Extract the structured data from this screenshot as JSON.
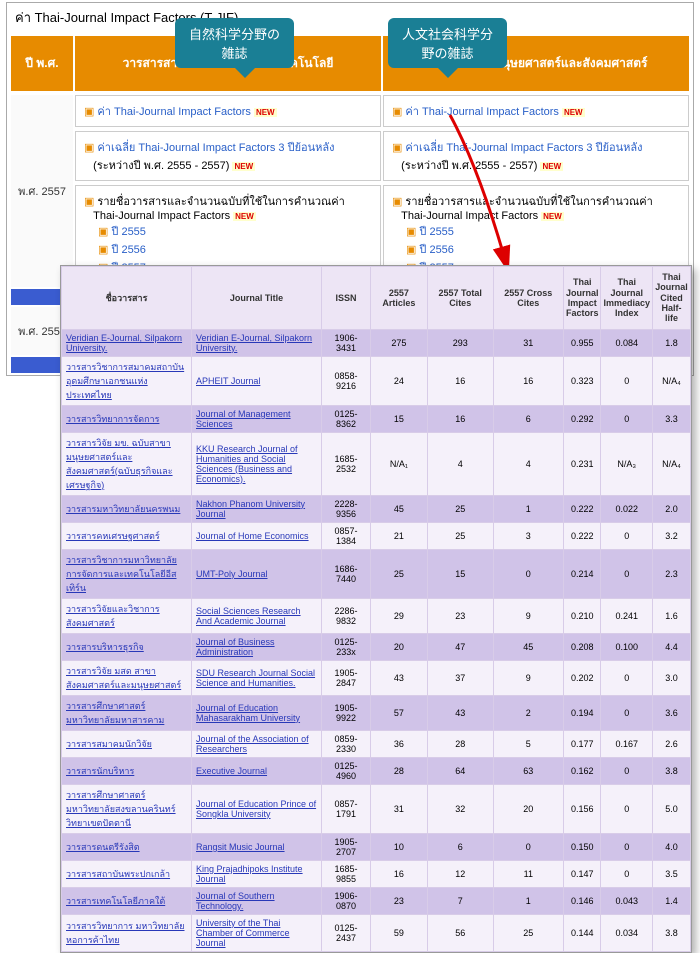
{
  "panel1": {
    "title": "ค่า Thai-Journal Impact Factors (T-JIF)",
    "callout1": "自然科学分野の<br>雑誌",
    "callout2": "人文社会科学分<br>野の雑誌",
    "year_hdr": "ปี พ.ศ.",
    "col1_hdr": "วารสารสาขาวิทยาศาสตร์และเทคโนโลยี",
    "col2_hdr": "วารสารสาขามนุษยศาสตร์และสังคมศาสตร์",
    "row_year": "พ.ศ. 2557",
    "link_a": "ค่า Thai-Journal Impact Factors",
    "avg_a": "ค่าเฉลี่ย Thai-Journal Impact Factors 3 ปีย้อนหลัง",
    "avg_a2": "(ระหว่างปี พ.ศ. 2555 - 2557)",
    "list_hdr": "รายชื่อวารสารและจำนวนฉบับที่ใช้ในการคำนวณค่า",
    "list_hdr2": "Thai-Journal Impact Factors",
    "y1": "ปี 2555",
    "y2": "ปี 2556",
    "y3": "ปี 2557",
    "row_year2": "พ.ศ. 2556",
    "new": "NEW"
  },
  "chart_data": {
    "type": "table",
    "columns": [
      "ชื่อวารสาร",
      "Journal Title",
      "ISSN",
      "2557 Articles",
      "2557 Total Cites",
      "2557 Cross Cites",
      "Thai Journal Impact Factors",
      "Thai Journal Immediacy Index",
      "Thai Journal Cited Half-life"
    ],
    "rows": [
      [
        "Veridian E-Journal, Silpakorn University.",
        "Veridian E-Journal, Silpakorn University.",
        "1906-3431",
        "275",
        "293",
        "31",
        "0.955",
        "0.084",
        "1.8"
      ],
      [
        "วารสารวิชาการสมาคมสถาบันอุดมศึกษาเอกชนแห่งประเทศไทย",
        "APHEIT Journal",
        "0858-9216",
        "24",
        "16",
        "16",
        "0.323",
        "0",
        "N/A₄"
      ],
      [
        "วารสารวิทยาการจัดการ",
        "Journal of Management Sciences",
        "0125-8362",
        "15",
        "16",
        "6",
        "0.292",
        "0",
        "3.3"
      ],
      [
        "วารสารวิจัย มข. ฉบับสาขามนุษยศาสตร์และสังคมศาสตร์(ฉบับธุรกิจและเศรษฐกิจ)",
        "KKU Research Journal of Humanities and Social Sciences (Business and Economics).",
        "1685-2532",
        "N/A₁",
        "4",
        "4",
        "0.231",
        "N/A₃",
        "N/A₄"
      ],
      [
        "วารสารมหาวิทยาลัยนครพนม",
        "Nakhon Phanom University Journal",
        "2228-9356",
        "45",
        "25",
        "1",
        "0.222",
        "0.022",
        "2.0"
      ],
      [
        "วารสารคหเศรษฐศาสตร์",
        "Journal of Home Economics",
        "0857-1384",
        "21",
        "25",
        "3",
        "0.222",
        "0",
        "3.2"
      ],
      [
        "วารสารวิชาการมหาวิทยาลัยการจัดการและเทคโนโลยีอีสเทิร์น",
        "UMT-Poly Journal",
        "1686-7440",
        "25",
        "15",
        "0",
        "0.214",
        "0",
        "2.3"
      ],
      [
        "วารสารวิจัยและวิชาการสังคมศาสตร์",
        "Social Sciences Research And Academic Journal",
        "2286-9832",
        "29",
        "23",
        "9",
        "0.210",
        "0.241",
        "1.6"
      ],
      [
        "วารสารบริหารธุรกิจ",
        "Journal of Business Administration",
        "0125-233x",
        "20",
        "47",
        "45",
        "0.208",
        "0.100",
        "4.4"
      ],
      [
        "วารสารวิจัย มสด สาขาสังคมศาสตร์และมนุษยศาสตร์",
        "SDU Research Journal Social Science and Humanities.",
        "1905-2847",
        "43",
        "37",
        "9",
        "0.202",
        "0",
        "3.0"
      ],
      [
        "วารสารศึกษาศาสตร์ มหาวิทยาลัยมหาสารคาม",
        "Journal of Education Mahasarakham University",
        "1905-9922",
        "57",
        "43",
        "2",
        "0.194",
        "0",
        "3.6"
      ],
      [
        "วารสารสมาคมนักวิจัย",
        "Journal of the Association of Researchers",
        "0859-2330",
        "36",
        "28",
        "5",
        "0.177",
        "0.167",
        "2.6"
      ],
      [
        "วารสารนักบริหาร",
        "Executive Journal",
        "0125-4960",
        "28",
        "64",
        "63",
        "0.162",
        "0",
        "3.8"
      ],
      [
        "วารสารศึกษาศาสตร์ มหาวิทยาลัยสงขลานครินทร์ วิทยาเขตปัตตานี",
        "Journal of Education Prince of Songkla University",
        "0857-1791",
        "31",
        "32",
        "20",
        "0.156",
        "0",
        "5.0"
      ],
      [
        "วารสารดนตรีรังสิต",
        "Rangsit Music Journal",
        "1905-2707",
        "10",
        "6",
        "0",
        "0.150",
        "0",
        "4.0"
      ],
      [
        "วารสารสถาบันพระปกเกล้า",
        "King Prajadhipoks Institute Journal",
        "1685-9855",
        "16",
        "12",
        "11",
        "0.147",
        "0",
        "3.5"
      ],
      [
        "วารสารเทคโนโลยีภาคใต้",
        "Journal of Southern Technology.",
        "1906-0870",
        "23",
        "7",
        "1",
        "0.146",
        "0.043",
        "1.4"
      ],
      [
        "วารสารวิทยาการ มหาวิทยาลัยหอการค้าไทย",
        "University of the Thai Chamber of Commerce Journal",
        "0125-2437",
        "59",
        "56",
        "25",
        "0.144",
        "0.034",
        "3.8"
      ]
    ]
  }
}
